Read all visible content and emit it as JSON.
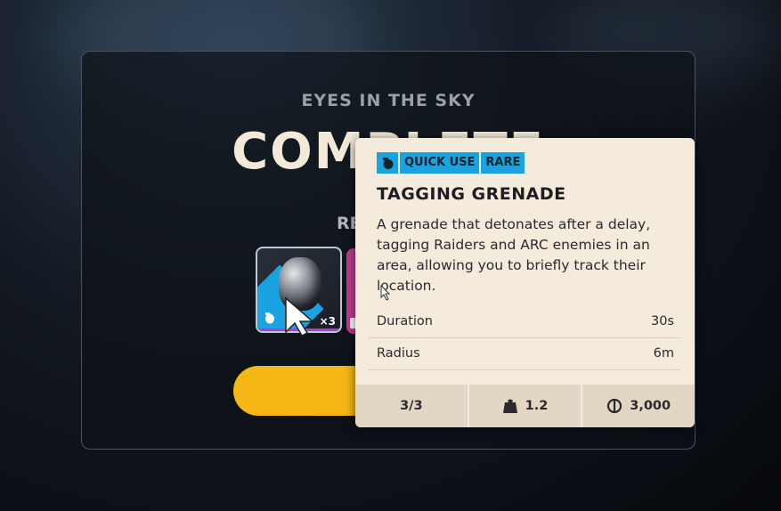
{
  "quest": {
    "title": "EYES IN THE SKY",
    "status": "COMPLETE",
    "rewards_label": "RE"
  },
  "reward_slot": {
    "quantity": "×3",
    "icon": "grenade-icon"
  },
  "tooltip": {
    "tags": [
      "QUICK USE",
      "RARE"
    ],
    "tag_icon": "grenade-icon",
    "item_name": "TAGGING GRENADE",
    "description": "A grenade that detonates after a delay, tagging Raiders and ARC enemies in an area, allowing you to briefly track their location.",
    "stats": [
      {
        "label": "Duration",
        "value": "30s"
      },
      {
        "label": "Radius",
        "value": "6m"
      }
    ],
    "footer": {
      "stack": "3/3",
      "weight": "1.2",
      "weight_icon": "weight-icon",
      "value": "3,000",
      "value_icon": "coin-icon"
    }
  },
  "colors": {
    "accent_blue": "#19a3e0",
    "button_yellow": "#f6b816",
    "tooltip_bg": "#f4ebdc",
    "rarity_magenta": "#c23a8f"
  }
}
